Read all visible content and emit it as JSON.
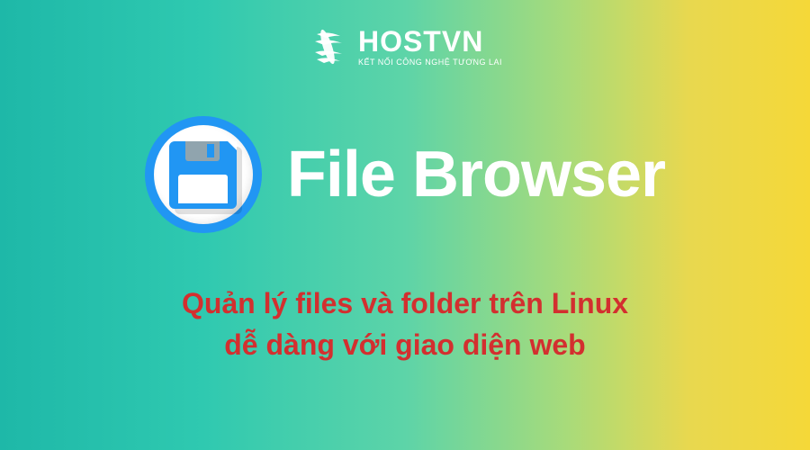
{
  "logo": {
    "brand": "HOSTVN",
    "tagline": "KẾT NỐI CÔNG NGHỆ TƯƠNG LAI"
  },
  "hero": {
    "title": "File Browser"
  },
  "subtitle": {
    "line1": "Quản lý files và folder trên Linux",
    "line2": "dễ dàng với giao diện web"
  }
}
